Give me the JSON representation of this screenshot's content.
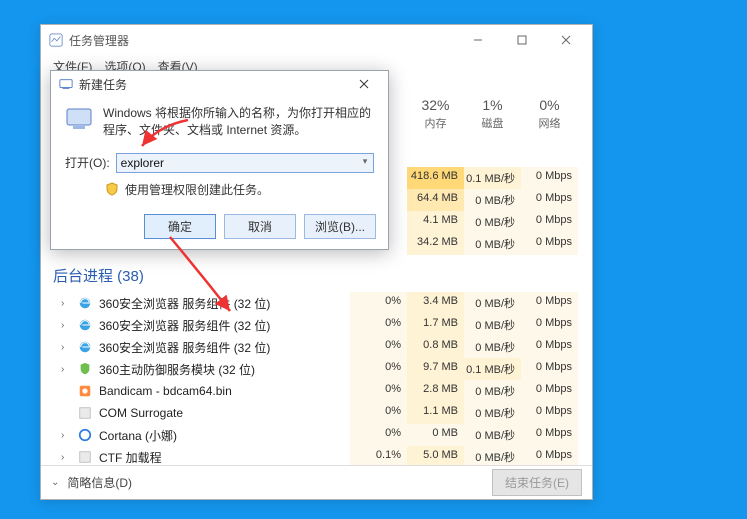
{
  "taskmgr": {
    "title": "任务管理器",
    "menu": {
      "file": "文件(F)",
      "options": "选项(O)",
      "view": "查看(V)"
    },
    "headers": {
      "cpu": {
        "pct": "32%",
        "label": "内存"
      },
      "mem": {
        "pct": "1%",
        "label": "磁盘"
      },
      "disk": {
        "pct": "0%",
        "label": "网络"
      }
    },
    "apps_rows": [
      {
        "cpu": "",
        "mem": "418.6 MB",
        "disk": "0.1 MB/秒",
        "net": "0 Mbps",
        "mem_cls": "bg-warm3",
        "disk_cls": "bg-warm1",
        "net_cls": "bg-pale"
      },
      {
        "cpu": "",
        "mem": "64.4 MB",
        "disk": "0 MB/秒",
        "net": "0 Mbps",
        "mem_cls": "bg-warm2",
        "disk_cls": "bg-pale",
        "net_cls": "bg-pale"
      },
      {
        "cpu": "",
        "mem": "4.1 MB",
        "disk": "0 MB/秒",
        "net": "0 Mbps",
        "mem_cls": "bg-warm1",
        "disk_cls": "bg-pale",
        "net_cls": "bg-pale"
      },
      {
        "cpu": "",
        "mem": "34.2 MB",
        "disk": "0 MB/秒",
        "net": "0 Mbps",
        "mem_cls": "bg-warm1",
        "disk_cls": "bg-pale",
        "net_cls": "bg-pale"
      }
    ],
    "bg_section": {
      "title": "后台进程 (38)"
    },
    "bg_rows": [
      {
        "name": "360安全浏览器 服务组件 (32 位)",
        "exp": "›",
        "icon": "ie",
        "cpu": "0%",
        "mem": "3.4 MB",
        "disk": "0 MB/秒",
        "net": "0 Mbps",
        "cpu_cls": "bg-pale",
        "mem_cls": "bg-warm1",
        "disk_cls": "bg-pale",
        "net_cls": "bg-pale"
      },
      {
        "name": "360安全浏览器 服务组件 (32 位)",
        "exp": "›",
        "icon": "ie",
        "cpu": "0%",
        "mem": "1.7 MB",
        "disk": "0 MB/秒",
        "net": "0 Mbps",
        "cpu_cls": "bg-pale",
        "mem_cls": "bg-warm1",
        "disk_cls": "bg-pale",
        "net_cls": "bg-pale"
      },
      {
        "name": "360安全浏览器 服务组件 (32 位)",
        "exp": "›",
        "icon": "ie",
        "cpu": "0%",
        "mem": "0.8 MB",
        "disk": "0 MB/秒",
        "net": "0 Mbps",
        "cpu_cls": "bg-pale",
        "mem_cls": "bg-warm1",
        "disk_cls": "bg-pale",
        "net_cls": "bg-pale"
      },
      {
        "name": "360主动防御服务模块 (32 位)",
        "exp": "›",
        "icon": "shield",
        "cpu": "0%",
        "mem": "9.7 MB",
        "disk": "0.1 MB/秒",
        "net": "0 Mbps",
        "cpu_cls": "bg-pale",
        "mem_cls": "bg-warm1",
        "disk_cls": "bg-warm1",
        "net_cls": "bg-pale"
      },
      {
        "name": "Bandicam - bdcam64.bin",
        "exp": "",
        "icon": "bandi",
        "cpu": "0%",
        "mem": "2.8 MB",
        "disk": "0 MB/秒",
        "net": "0 Mbps",
        "cpu_cls": "bg-pale",
        "mem_cls": "bg-warm1",
        "disk_cls": "bg-pale",
        "net_cls": "bg-pale"
      },
      {
        "name": "COM Surrogate",
        "exp": "",
        "icon": "blank",
        "cpu": "0%",
        "mem": "1.1 MB",
        "disk": "0 MB/秒",
        "net": "0 Mbps",
        "cpu_cls": "bg-pale",
        "mem_cls": "bg-warm1",
        "disk_cls": "bg-pale",
        "net_cls": "bg-pale"
      },
      {
        "name": "Cortana (小娜)",
        "exp": "›",
        "icon": "cortana",
        "cpu": "0%",
        "mem": "0 MB",
        "disk": "0 MB/秒",
        "net": "0 Mbps",
        "cpu_cls": "bg-pale",
        "mem_cls": "bg-pale",
        "disk_cls": "bg-pale",
        "net_cls": "bg-pale"
      },
      {
        "name": "CTF 加载程",
        "exp": "›",
        "icon": "blank",
        "cpu": "0.1%",
        "mem": "5.0 MB",
        "disk": "0 MB/秒",
        "net": "0 Mbps",
        "cpu_cls": "bg-pale",
        "mem_cls": "bg-warm1",
        "disk_cls": "bg-pale",
        "net_cls": "bg-pale"
      }
    ],
    "footer": {
      "label": "简略信息(D)",
      "end_task": "结束任务(E)"
    }
  },
  "run": {
    "title": "新建任务",
    "desc": "Windows 将根据你所输入的名称，为你打开相应的程序、文件夹、文档或 Internet 资源。",
    "open_label": "打开(O):",
    "value": "explorer",
    "admin_label": "使用管理权限创建此任务。",
    "ok": "确定",
    "cancel": "取消",
    "browse": "浏览(B)..."
  }
}
